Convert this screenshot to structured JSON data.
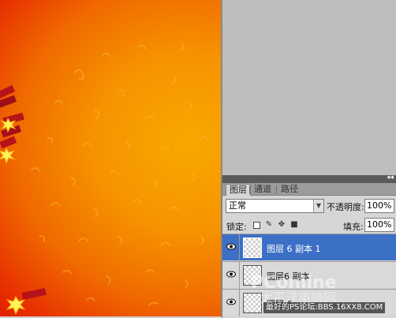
{
  "layers_panel": {
    "tabs": [
      {
        "label": "图层",
        "active": true
      },
      {
        "label": "通道",
        "active": false
      },
      {
        "label": "路径",
        "active": false
      }
    ],
    "blend_mode": "正常",
    "opacity_label": "不透明度:",
    "opacity_value": "100%",
    "lock_label": "锁定:",
    "fill_label": "填充:",
    "fill_value": "100%",
    "layers": [
      {
        "name": "图层 6 副本 1",
        "selected": true,
        "visible": true
      },
      {
        "name": "图层6 副本",
        "selected": false,
        "visible": true
      },
      {
        "name": "图层 6",
        "selected": false,
        "visible": true
      }
    ]
  },
  "watermark": {
    "brand": "PConline",
    "cn": "太平洋电脑网",
    "strip": "最好的PS论坛:BBS.16XX8.COM"
  },
  "colors": {
    "canvas_orange": "#f69400",
    "canvas_red": "#e41d00",
    "selection_blue": "#3c6fc6",
    "panel_bg": "#d6d6d6"
  }
}
